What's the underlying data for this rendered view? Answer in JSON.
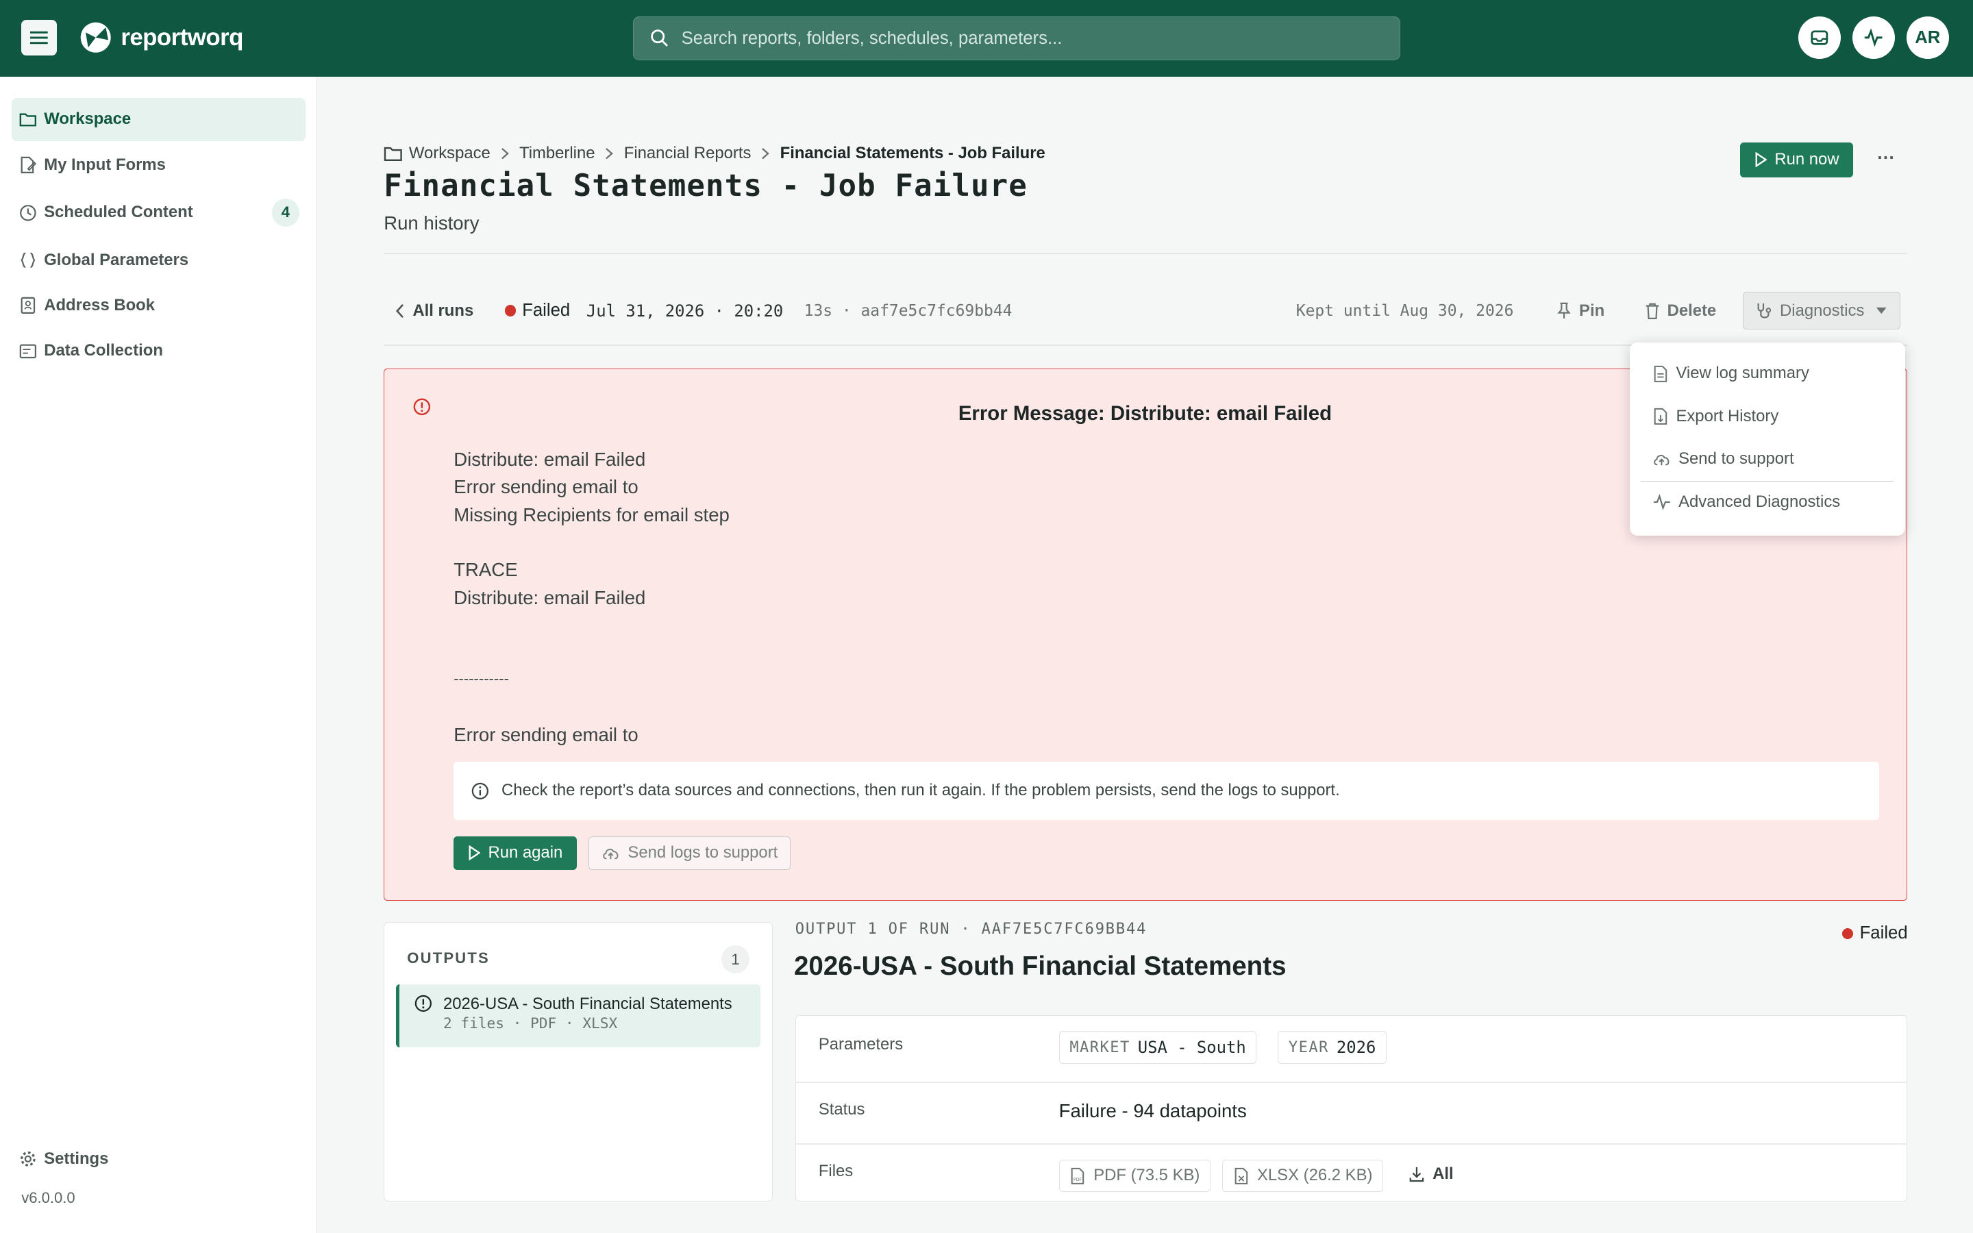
{
  "app": {
    "name": "reportworq",
    "avatar_initials": "AR",
    "version": "v6.0.0.0"
  },
  "search": {
    "placeholder": "Search reports, folders, schedules, parameters..."
  },
  "sidebar": {
    "items": [
      {
        "label": "Workspace"
      },
      {
        "label": "My Input Forms"
      },
      {
        "label": "Scheduled Content",
        "badge": "4"
      },
      {
        "label": "Global Parameters"
      },
      {
        "label": "Address Book"
      },
      {
        "label": "Data Collection"
      }
    ],
    "settings_label": "Settings"
  },
  "breadcrumb": [
    "Workspace",
    "Timberline",
    "Financial Reports",
    "Financial Statements - Job Failure"
  ],
  "page": {
    "title": "Financial Statements - Job Failure",
    "subtitle": "Run history"
  },
  "header_actions": {
    "run_now": "Run now",
    "more": "···"
  },
  "run": {
    "all_runs": "All runs",
    "status": "Failed",
    "datetime": "Jul 31, 2026 · 20:20",
    "duration_id": "13s · aaf7e5c7fc69bb44",
    "kept_until": "Kept until Aug 30, 2026",
    "pin": "Pin",
    "delete": "Delete",
    "diagnostics": "Diagnostics"
  },
  "diagnostics_menu": {
    "items": [
      "View log summary",
      "Export History",
      "Send to support",
      "Advanced Diagnostics"
    ]
  },
  "error": {
    "title": "Error Message: Distribute: email Failed",
    "lines": [
      "Distribute: email Failed",
      "Error sending email to",
      "Missing Recipients for email step",
      "TRACE",
      "Distribute: email Failed",
      "-----------",
      "Error sending email to"
    ],
    "hint": "Check the report’s data sources and connections, then run it again. If the problem persists, send the logs to support.",
    "run_again": "Run again",
    "send_logs": "Send logs to support"
  },
  "outputs": {
    "label": "OUTPUTS",
    "count": "1",
    "items": [
      {
        "title": "2026-USA - South Financial Statements",
        "meta": "2 files · PDF · XLSX"
      }
    ]
  },
  "detail": {
    "header": "OUTPUT 1 OF RUN · AAF7E5C7FC69BB44",
    "status": "Failed",
    "title": "2026-USA - South Financial Statements",
    "parameters_label": "Parameters",
    "params": [
      {
        "key": "MARKET",
        "value": "USA - South"
      },
      {
        "key": "YEAR",
        "value": "2026"
      }
    ],
    "status_label": "Status",
    "status_value": "Failure - 94 datapoints",
    "files_label": "Files",
    "files": [
      "PDF (73.5 KB)",
      "XLSX (26.2 KB)"
    ],
    "all_label": "All"
  },
  "colors": {
    "brand": "#0f5740",
    "accent": "#1f7a5a",
    "error_bg": "#fde8e8",
    "error_border": "#e04a4a",
    "failed_dot": "#d0352b"
  }
}
